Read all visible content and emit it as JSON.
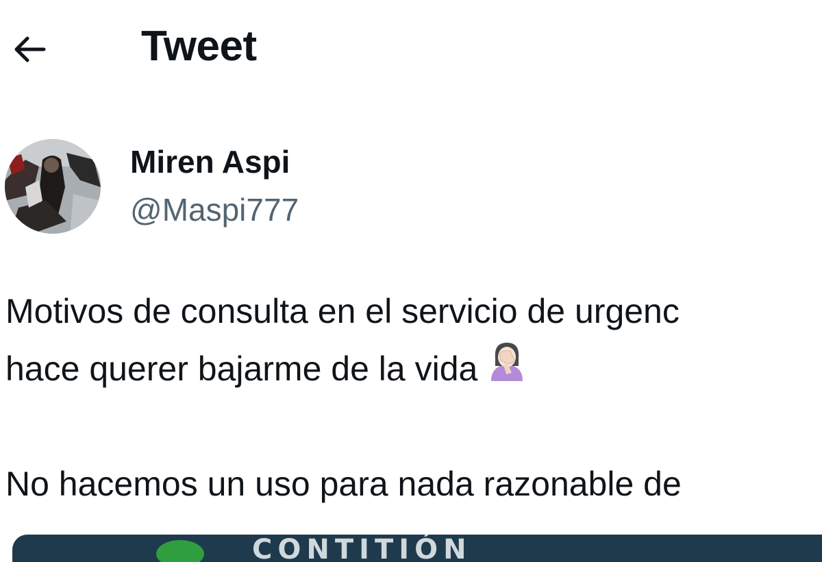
{
  "header": {
    "back_icon": "arrow-left-icon",
    "title": "Tweet"
  },
  "author": {
    "display_name": "Miren Aspi",
    "handle": "@Maspi777"
  },
  "tweet": {
    "lines": [
      "Motivos de consulta en el servicio de urgenc",
      "hace querer bajarme de la vida",
      "",
      "No hacemos un uso para nada razonable de"
    ],
    "emoji": "woman-facepalming-emoji"
  },
  "media": {
    "visible_text": "CONTITIÓN"
  },
  "colors": {
    "text_primary": "#0f1419",
    "text_secondary": "#536471",
    "background": "#ffffff",
    "media_bg": "#1f3a4d",
    "media_badge": "#2e9e3f"
  }
}
